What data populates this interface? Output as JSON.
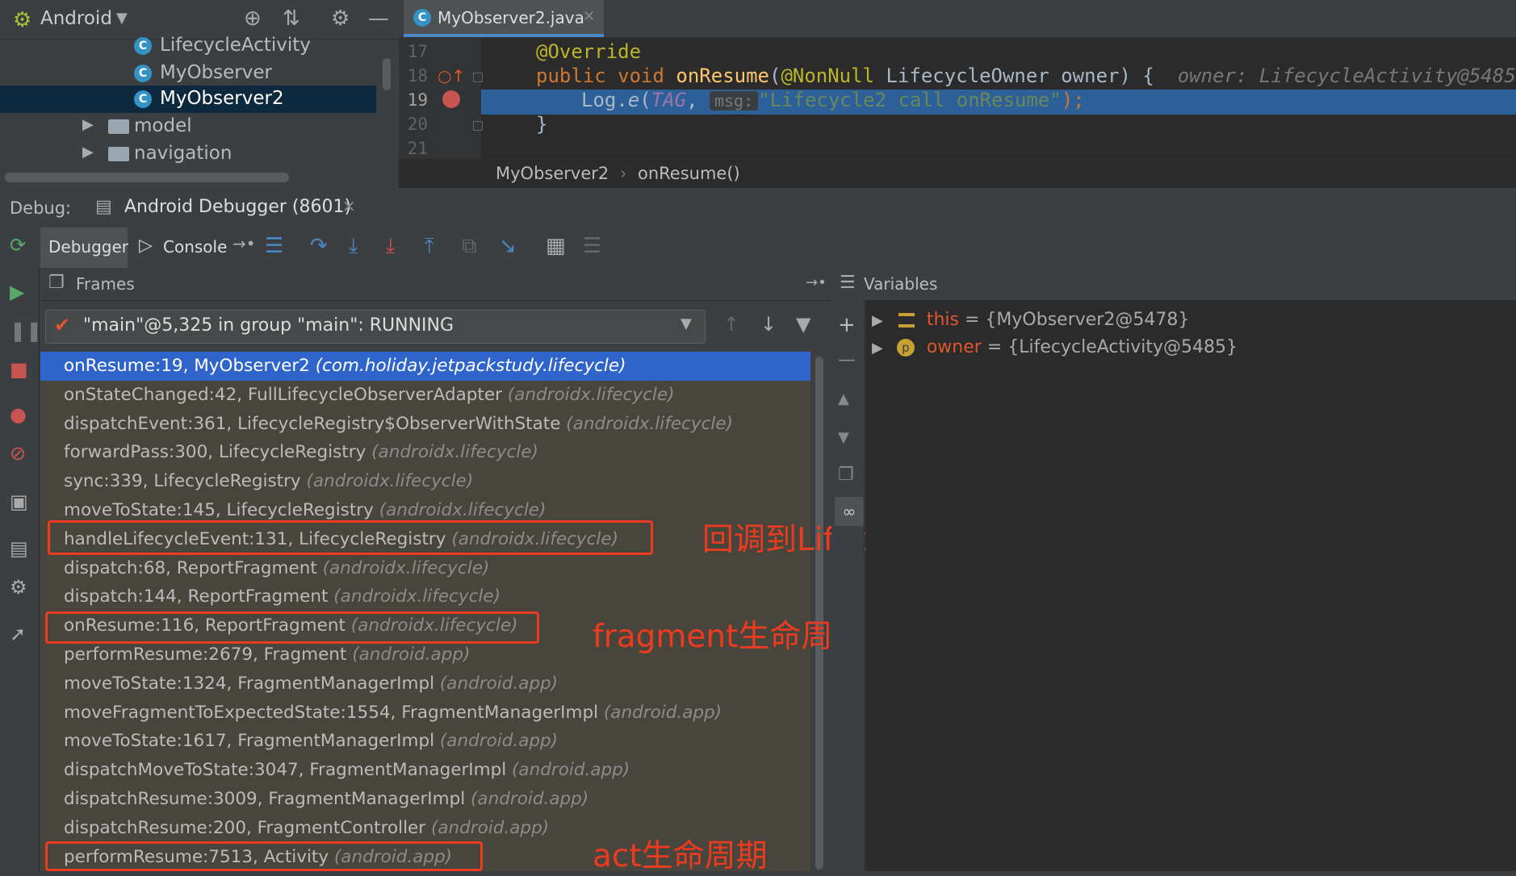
{
  "project": {
    "view_label": "Android",
    "items": [
      {
        "label": "LifecycleActivity",
        "type": "class"
      },
      {
        "label": "MyObserver",
        "type": "class"
      },
      {
        "label": "MyObserver2",
        "type": "class",
        "selected": true
      },
      {
        "label": "model",
        "type": "folder"
      },
      {
        "label": "navigation",
        "type": "folder"
      }
    ]
  },
  "editor": {
    "tab_label": "MyObserver2.java",
    "lines": [
      {
        "num": "17",
        "annotation": "@Override"
      },
      {
        "num": "18",
        "kw": "public void ",
        "fn": "onResume",
        "open": "(",
        "ann": "@NonNull ",
        "param": "LifecycleOwner owner) {",
        "inline_hint": "owner: LifecycleActivity@5485"
      },
      {
        "num": "19",
        "obj": "Log.",
        "call": "e",
        "open": "(",
        "tag": "TAG",
        "comma": ", ",
        "param_hint": "msg:",
        "str": "\"Lifecycle2 call onResume\"",
        "close": ");"
      },
      {
        "num": "20",
        "brace": "}"
      },
      {
        "num": "21"
      }
    ],
    "breadcrumb": [
      "MyObserver2",
      "onResume()"
    ]
  },
  "debug": {
    "label": "Debug:",
    "session_tab": "Android Debugger (8601)",
    "tabs": {
      "debugger": "Debugger",
      "console": "Console"
    },
    "frames_title": "Frames",
    "variables_title": "Variables",
    "thread": "\"main\"@5,325 in group \"main\": RUNNING",
    "frames": [
      {
        "method": "onResume:19, MyObserver2",
        "pkg": "(com.holiday.jetpackstudy.lifecycle)",
        "selected": true
      },
      {
        "method": "onStateChanged:42, FullLifecycleObserverAdapter",
        "pkg": "(androidx.lifecycle)"
      },
      {
        "method": "dispatchEvent:361, LifecycleRegistry$ObserverWithState",
        "pkg": "(androidx.lifecycle)"
      },
      {
        "method": "forwardPass:300, LifecycleRegistry",
        "pkg": "(androidx.lifecycle)"
      },
      {
        "method": "sync:339, LifecycleRegistry",
        "pkg": "(androidx.lifecycle)"
      },
      {
        "method": "moveToState:145, LifecycleRegistry",
        "pkg": "(androidx.lifecycle)"
      },
      {
        "method": "handleLifecycleEvent:131, LifecycleRegistry",
        "pkg": "(androidx.lifecycle)"
      },
      {
        "method": "dispatch:68, ReportFragment",
        "pkg": "(androidx.lifecycle)"
      },
      {
        "method": "dispatch:144, ReportFragment",
        "pkg": "(androidx.lifecycle)"
      },
      {
        "method": "onResume:116, ReportFragment",
        "pkg": "(androidx.lifecycle)"
      },
      {
        "method": "performResume:2679, Fragment",
        "pkg": "(android.app)"
      },
      {
        "method": "moveToState:1324, FragmentManagerImpl",
        "pkg": "(android.app)"
      },
      {
        "method": "moveFragmentToExpectedState:1554, FragmentManagerImpl",
        "pkg": "(android.app)"
      },
      {
        "method": "moveToState:1617, FragmentManagerImpl",
        "pkg": "(android.app)"
      },
      {
        "method": "dispatchMoveToState:3047, FragmentManagerImpl",
        "pkg": "(android.app)"
      },
      {
        "method": "dispatchResume:3009, FragmentManagerImpl",
        "pkg": "(android.app)"
      },
      {
        "method": "dispatchResume:200, FragmentController",
        "pkg": "(android.app)"
      },
      {
        "method": "performResume:7513, Activity",
        "pkg": "(android.app)"
      }
    ],
    "annotations": [
      {
        "text": "回调到LifecycleRegistry"
      },
      {
        "text": "fragment生命周期"
      },
      {
        "text": "act生命周期"
      }
    ],
    "variables": [
      {
        "name": "this",
        "value": "= {MyObserver2@5478}",
        "icon": "field-icon"
      },
      {
        "name": "owner",
        "value": "= {LifecycleActivity@5485}",
        "icon": "param-icon",
        "icon_letter": "p"
      }
    ]
  },
  "colors": {
    "selection": "#2f65ca",
    "execution_line": "#2d6099",
    "annotation_red": "#ec3b1f"
  }
}
